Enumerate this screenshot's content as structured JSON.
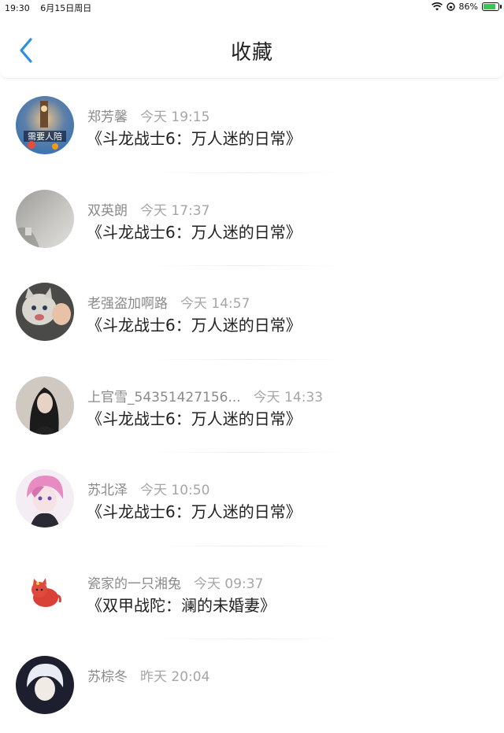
{
  "status_bar": {
    "time": "19:30",
    "date": "6月15日周日",
    "battery_text": "86%",
    "battery_level": 0.86,
    "battery_color": "#34c759"
  },
  "nav": {
    "title": "收藏",
    "back_icon": "chevron-left-icon",
    "accent": "#2b8fe5"
  },
  "items": [
    {
      "user": "郑芳馨",
      "time": "今天 19:15",
      "title": "《斗龙战士6：万人迷的日常》",
      "avatar": "city-night"
    },
    {
      "user": "双英朗",
      "time": "今天 17:37",
      "title": "《斗龙战士6：万人迷的日常》",
      "avatar": "grey-photo"
    },
    {
      "user": "老强盗加啊路",
      "time": "今天 14:57",
      "title": "《斗龙战士6：万人迷的日常》",
      "avatar": "cat-photo"
    },
    {
      "user": "上官雪_54351427156...",
      "time": "今天 14:33",
      "title": "《斗龙战士6：万人迷的日常》",
      "avatar": "girl-photo"
    },
    {
      "user": "苏北泽",
      "time": "今天 10:50",
      "title": "《斗龙战士6：万人迷的日常》",
      "avatar": "anime-pink"
    },
    {
      "user": "瓷家的一只湘兔",
      "time": "今天 09:37",
      "title": "《双甲战陀：澜的未婚妻》",
      "avatar": "red-cat"
    },
    {
      "user": "苏棕冬",
      "time": "昨天 20:04",
      "title": "",
      "avatar": "anime-dark"
    }
  ]
}
